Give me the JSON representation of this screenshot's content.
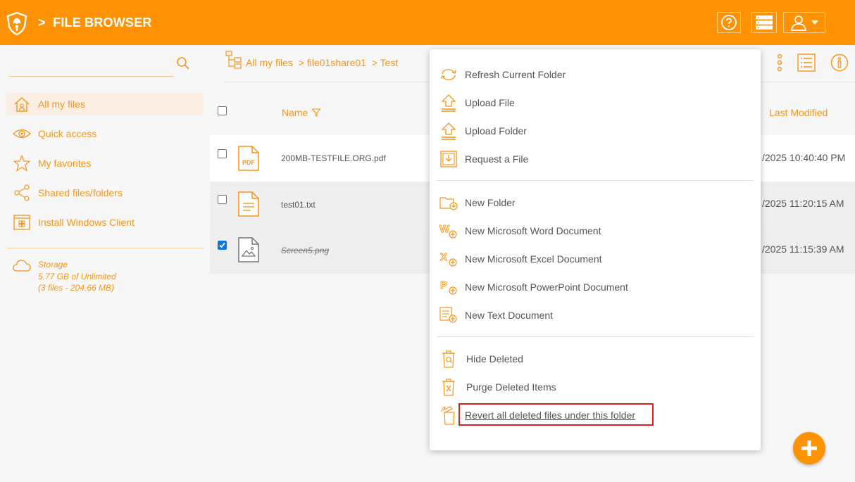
{
  "header": {
    "title": "FILE BROWSER",
    "separator": ">",
    "help_icon": "help-icon",
    "server_icon": "server-icon",
    "user_icon": "user-icon"
  },
  "sidebar": {
    "items": [
      {
        "label": "All my files",
        "icon": "home-icon",
        "active": true
      },
      {
        "label": "Quick access",
        "icon": "eye-icon"
      },
      {
        "label": "My favorites",
        "icon": "star-icon"
      },
      {
        "label": "Shared files/folders",
        "icon": "share-icon"
      },
      {
        "label": "Install Windows Client",
        "icon": "windows-client-icon"
      }
    ],
    "storage": {
      "title": "Storage",
      "usage": "5.77 GB of Unlimited",
      "files": "(3 files - 204.66 MB)"
    }
  },
  "breadcrumb": {
    "items": [
      "All my files",
      "> file01share01",
      "> Test"
    ]
  },
  "table": {
    "headers": {
      "name": "Name",
      "modified": "Last Modified"
    },
    "rows": [
      {
        "name": "200MB-TESTFILE.ORG.pdf",
        "modified": "/2025 10:40:40 PM",
        "checked": false,
        "deleted": false,
        "icon": "pdf-icon",
        "icon_text": "PDF"
      },
      {
        "name": "test01.txt",
        "modified": "/2025 11:20:15 AM",
        "checked": false,
        "deleted": false,
        "icon": "text-file-icon"
      },
      {
        "name": "Screen5.png",
        "modified": "/2025 11:15:39 AM",
        "checked": true,
        "deleted": true,
        "icon": "image-file-icon"
      }
    ]
  },
  "menu": {
    "items": [
      {
        "label": "Refresh Current Folder",
        "icon": "refresh-icon"
      },
      {
        "label": "Upload File",
        "icon": "upload-file-icon"
      },
      {
        "label": "Upload Folder",
        "icon": "upload-folder-icon"
      },
      {
        "label": "Request a File",
        "icon": "request-file-icon"
      },
      {
        "label": "New Folder",
        "icon": "new-folder-icon"
      },
      {
        "label": "New Microsoft Word Document",
        "icon": "new-word-icon"
      },
      {
        "label": "New Microsoft Excel Document",
        "icon": "new-excel-icon"
      },
      {
        "label": "New Microsoft PowerPoint Document",
        "icon": "new-powerpoint-icon"
      },
      {
        "label": "New Text Document",
        "icon": "new-text-icon"
      },
      {
        "label": "Hide Deleted",
        "icon": "hide-deleted-icon"
      },
      {
        "label": "Purge Deleted Items",
        "icon": "purge-icon"
      },
      {
        "label": "Revert all deleted files under this folder",
        "icon": "revert-icon"
      }
    ]
  },
  "colors": {
    "brand": "#fd9304",
    "accent_text": "#f39619",
    "highlight_border": "#e02020",
    "checkbox": "#0b76e0"
  }
}
